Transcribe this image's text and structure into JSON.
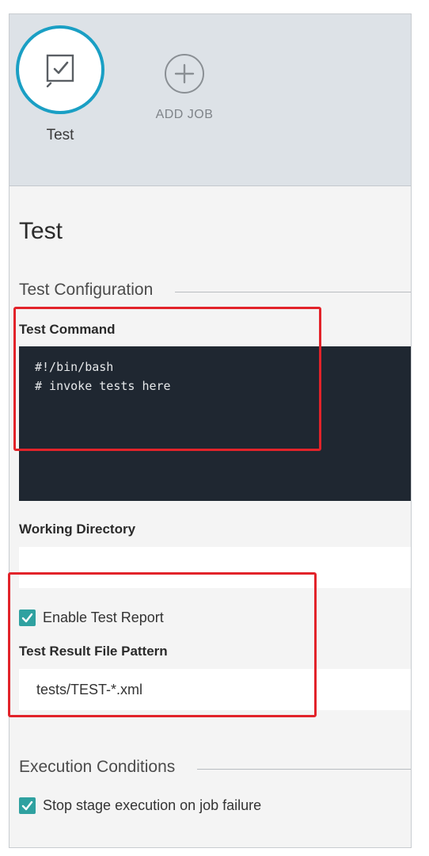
{
  "jobs": {
    "current": {
      "label": "Test",
      "icon": "test-checkbox-icon"
    },
    "add": {
      "label": "ADD JOB",
      "icon": "plus-circle-icon"
    }
  },
  "page_title": "Test",
  "test_configuration": {
    "heading": "Test Configuration",
    "test_command_label": "Test Command",
    "test_command_lines": [
      "#!/bin/bash",
      "# invoke tests here"
    ],
    "working_directory_label": "Working Directory",
    "working_directory_value": "",
    "enable_test_report_label": "Enable Test Report",
    "enable_test_report_checked": true,
    "result_pattern_label": "Test Result File Pattern",
    "result_pattern_value": "tests/TEST-*.xml"
  },
  "execution_conditions": {
    "heading": "Execution Conditions",
    "stop_on_failure_label": "Stop stage execution on job failure",
    "stop_on_failure_checked": true
  },
  "colors": {
    "accent": "#1a9fc4",
    "checkbox": "#2fa1a0",
    "code_bg": "#1f2731",
    "annotation": "#e2232a"
  }
}
